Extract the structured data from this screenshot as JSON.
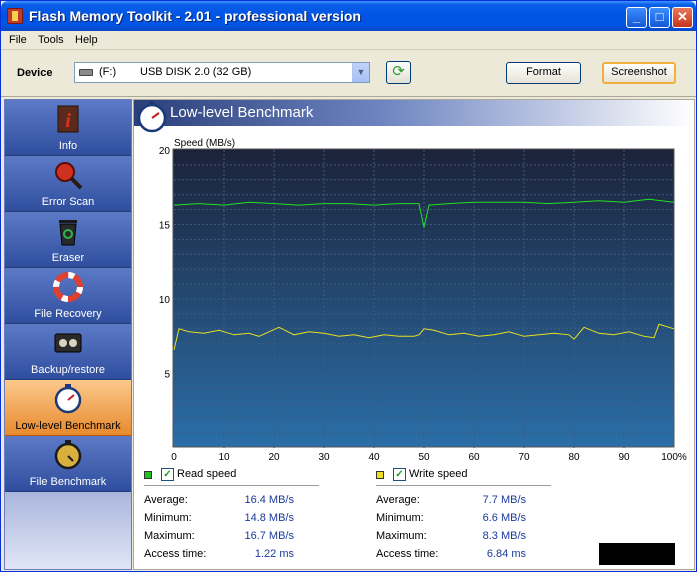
{
  "window": {
    "title": "Flash Memory Toolkit - 2.01 - professional version",
    "controls": {
      "minimize": "_",
      "maximize": "□",
      "close": "✕"
    }
  },
  "menu": {
    "items": [
      "File",
      "Tools",
      "Help"
    ]
  },
  "toolbar": {
    "device_label": "Device",
    "device_letter": "(F:)",
    "device_name": "USB DISK 2.0 (32 GB)",
    "refresh_icon": "refresh-icon",
    "format_label": "Format",
    "screenshot_label": "Screenshot"
  },
  "sidebar": {
    "items": [
      {
        "label": "Info",
        "icon": "info-icon"
      },
      {
        "label": "Error Scan",
        "icon": "magnifier-icon"
      },
      {
        "label": "Eraser",
        "icon": "recycle-bin-icon"
      },
      {
        "label": "File Recovery",
        "icon": "lifebuoy-icon"
      },
      {
        "label": "Backup/restore",
        "icon": "tape-icon"
      },
      {
        "label": "Low-level Benchmark",
        "icon": "stopwatch-icon",
        "active": true
      },
      {
        "label": "File Benchmark",
        "icon": "stopwatch-dark-icon"
      }
    ]
  },
  "main": {
    "title": "Low-level Benchmark"
  },
  "chart_data": {
    "type": "line",
    "ylabel": "Speed (MB/s)",
    "ylim": [
      0,
      20
    ],
    "yticks": [
      5,
      10,
      15,
      20
    ],
    "xlim": [
      0,
      100
    ],
    "xticks": [
      "0",
      "10",
      "20",
      "30",
      "40",
      "50",
      "60",
      "70",
      "80",
      "90",
      "100%"
    ],
    "grid": true,
    "series": [
      {
        "name": "Read speed",
        "color": "#22e022",
        "x": [
          0,
          5,
          10,
          15,
          20,
          25,
          30,
          35,
          40,
          45,
          49,
          50,
          51,
          55,
          60,
          65,
          70,
          75,
          80,
          85,
          90,
          95,
          100
        ],
        "values": [
          16.3,
          16.4,
          16.3,
          16.5,
          16.4,
          16.3,
          16.4,
          16.4,
          16.3,
          16.4,
          16.4,
          14.8,
          16.3,
          16.4,
          16.5,
          16.5,
          16.5,
          16.4,
          16.5,
          16.6,
          16.5,
          16.7,
          16.5
        ]
      },
      {
        "name": "Write speed",
        "color": "#e8e020",
        "x": [
          0,
          1,
          3,
          6,
          9,
          12,
          15,
          17,
          19,
          21,
          24,
          27,
          30,
          33,
          36,
          39,
          42,
          45,
          48,
          49,
          50,
          52,
          55,
          58,
          61,
          64,
          67,
          70,
          73,
          76,
          79,
          80,
          82,
          85,
          88,
          91,
          94,
          96,
          97,
          100
        ],
        "values": [
          6.6,
          8.0,
          7.8,
          7.7,
          7.9,
          7.6,
          7.7,
          7.5,
          7.8,
          8.1,
          7.6,
          7.8,
          7.7,
          7.5,
          7.6,
          7.4,
          7.6,
          7.5,
          7.5,
          7.6,
          8.0,
          7.9,
          7.6,
          7.7,
          7.5,
          7.6,
          7.8,
          7.5,
          7.6,
          7.7,
          7.6,
          7.3,
          8.1,
          7.7,
          7.6,
          7.8,
          7.5,
          7.4,
          8.3,
          8.0
        ]
      }
    ]
  },
  "stats": {
    "read": {
      "legend": "Read speed",
      "checked": "✓",
      "color": "#22c022",
      "rows": [
        {
          "label": "Average:",
          "value": "16.4 MB/s"
        },
        {
          "label": "Minimum:",
          "value": "14.8 MB/s"
        },
        {
          "label": "Maximum:",
          "value": "16.7 MB/s"
        },
        {
          "label": "Access time:",
          "value": "1.22 ms"
        }
      ]
    },
    "write": {
      "legend": "Write speed",
      "checked": "✓",
      "color": "#f0e020",
      "rows": [
        {
          "label": "Average:",
          "value": "7.7 MB/s"
        },
        {
          "label": "Minimum:",
          "value": "6.6 MB/s"
        },
        {
          "label": "Maximum:",
          "value": "8.3 MB/s"
        },
        {
          "label": "Access time:",
          "value": "6.84 ms"
        }
      ]
    }
  }
}
